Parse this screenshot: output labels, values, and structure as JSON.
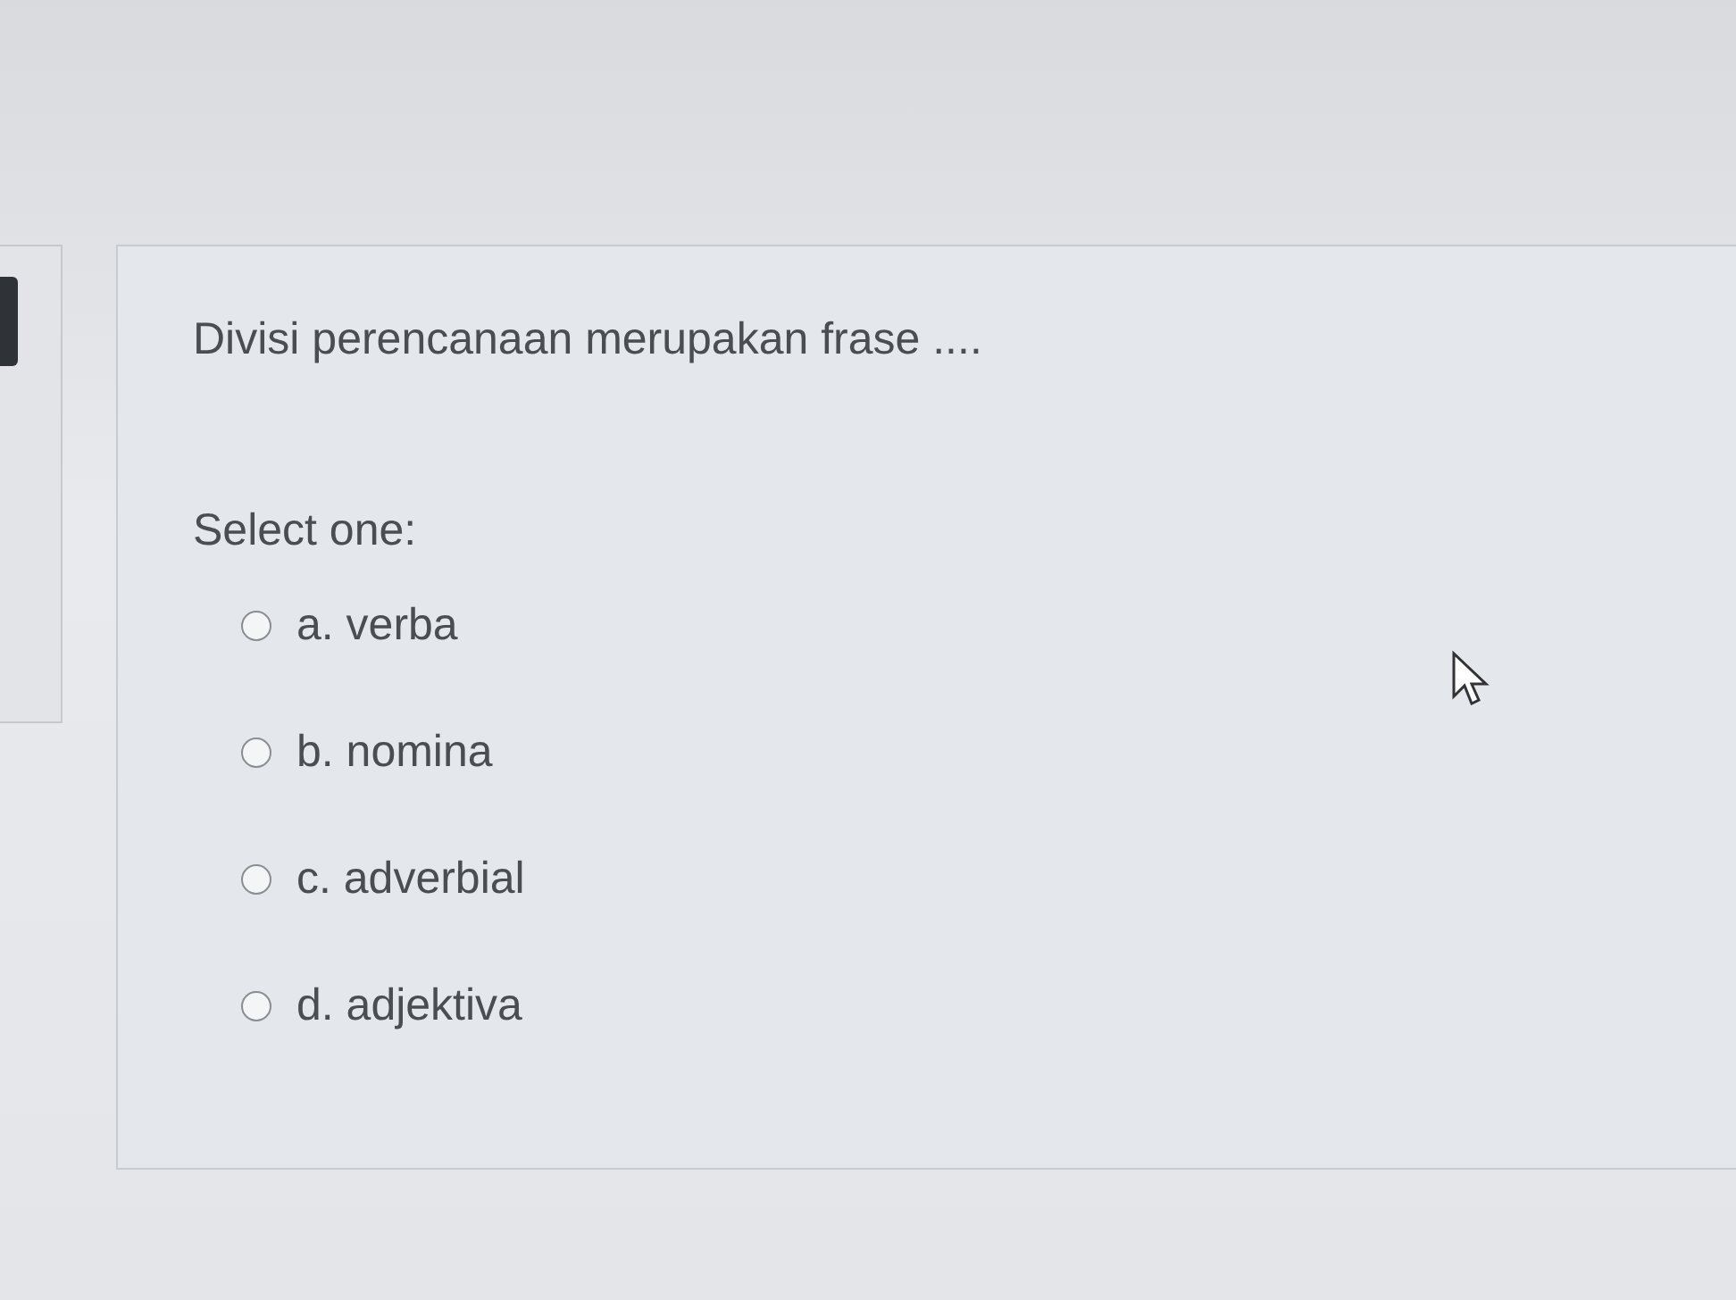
{
  "question": {
    "text": "Divisi perencanaan merupakan frase ....",
    "prompt": "Select one:",
    "options": [
      {
        "label": "a. verba",
        "selected": false
      },
      {
        "label": "b. nomina",
        "selected": false
      },
      {
        "label": "c. adverbial",
        "selected": false
      },
      {
        "label": "d. adjektiva",
        "selected": false
      }
    ]
  }
}
